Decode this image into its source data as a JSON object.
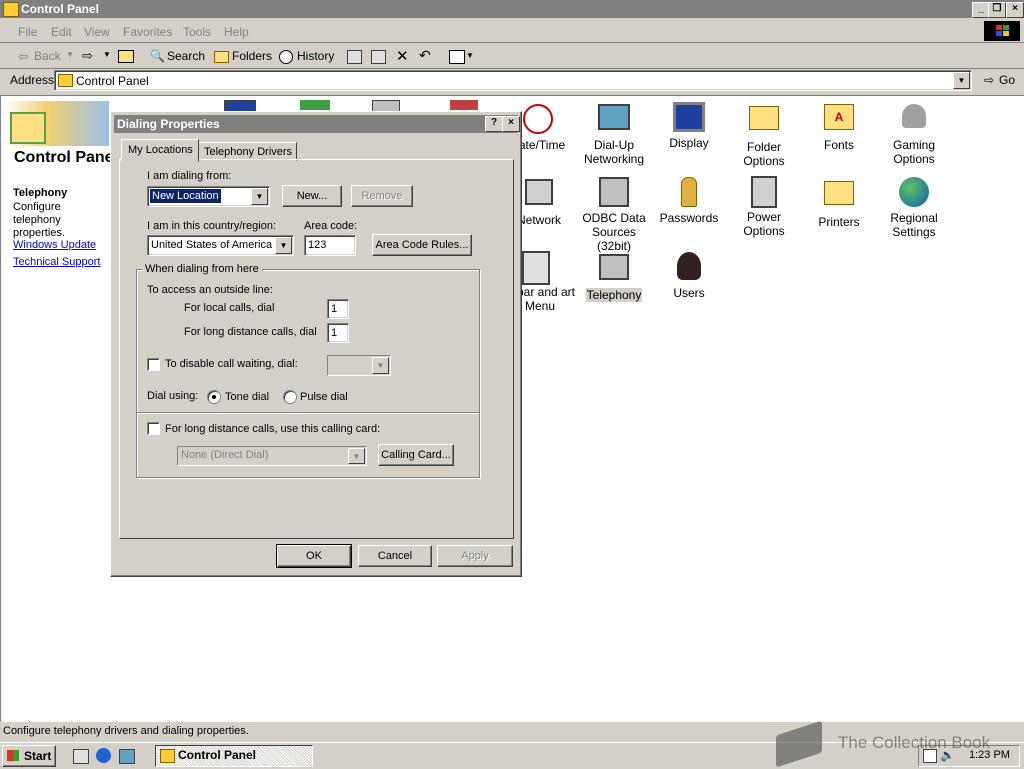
{
  "window": {
    "title": "Control Panel"
  },
  "menu": [
    "File",
    "Edit",
    "View",
    "Favorites",
    "Tools",
    "Help"
  ],
  "toolbar": {
    "back": "Back",
    "search": "Search",
    "folders": "Folders",
    "history": "History"
  },
  "address": {
    "label": "Address",
    "value": "Control Panel",
    "go": "Go"
  },
  "sidebar": {
    "title": "Control Panel",
    "section_title": "Telephony",
    "description": "Configure telephony properties.",
    "links": [
      "Windows Update",
      "Technical Support"
    ]
  },
  "icons": [
    {
      "label": "ate/Time",
      "icon": "clock-icon"
    },
    {
      "label": "Dial-Up Networking",
      "icon": "dialup-icon"
    },
    {
      "label": "Display",
      "icon": "display-icon"
    },
    {
      "label": "Folder Options",
      "icon": "folder-options-icon"
    },
    {
      "label": "Fonts",
      "icon": "fonts-icon"
    },
    {
      "label": "Gaming Options",
      "icon": "joystick-icon"
    },
    {
      "label": "Network",
      "icon": "network-icon"
    },
    {
      "label": "ODBC Data Sources (32bit)",
      "icon": "odbc-icon"
    },
    {
      "label": "Passwords",
      "icon": "keys-icon"
    },
    {
      "label": "Power Options",
      "icon": "power-icon"
    },
    {
      "label": "Printers",
      "icon": "printer-icon"
    },
    {
      "label": "Regional Settings",
      "icon": "globe-icon"
    },
    {
      "label": "skbar and art Menu",
      "icon": "taskbar-icon"
    },
    {
      "label": "Telephony",
      "icon": "telephony-icon"
    },
    {
      "label": "Users",
      "icon": "users-icon"
    }
  ],
  "dialog": {
    "title": "Dialing Properties",
    "help": "?",
    "close": "×",
    "tabs": [
      "My Locations",
      "Telephony Drivers"
    ],
    "dialing_from_label": "I am dialing from:",
    "dialing_from_value": "New Location",
    "new_button": "New...",
    "remove_button": "Remove",
    "country_label": "I am in this country/region:",
    "country_value": "United States of America",
    "area_code_label": "Area code:",
    "area_code_value": "123",
    "area_code_rules_button": "Area Code Rules...",
    "group_title": "When dialing from here",
    "outside_line_label": "To access an outside line:",
    "local_label": "For local calls, dial",
    "local_value": "1",
    "long_label": "For long distance calls, dial",
    "long_value": "1",
    "call_waiting_label": "To disable call waiting, dial:",
    "dial_using_label": "Dial using:",
    "tone_label": "Tone dial",
    "pulse_label": "Pulse dial",
    "calling_card_label": "For long distance calls, use this calling card:",
    "calling_card_value": "None (Direct Dial)",
    "calling_card_button": "Calling Card...",
    "ok": "OK",
    "cancel": "Cancel",
    "apply": "Apply"
  },
  "status": {
    "text": "Configure telephony drivers and dialing properties."
  },
  "taskbar": {
    "start": "Start",
    "task": "Control Panel",
    "clock": "1:23 PM"
  },
  "watermark": "The Collection Book"
}
